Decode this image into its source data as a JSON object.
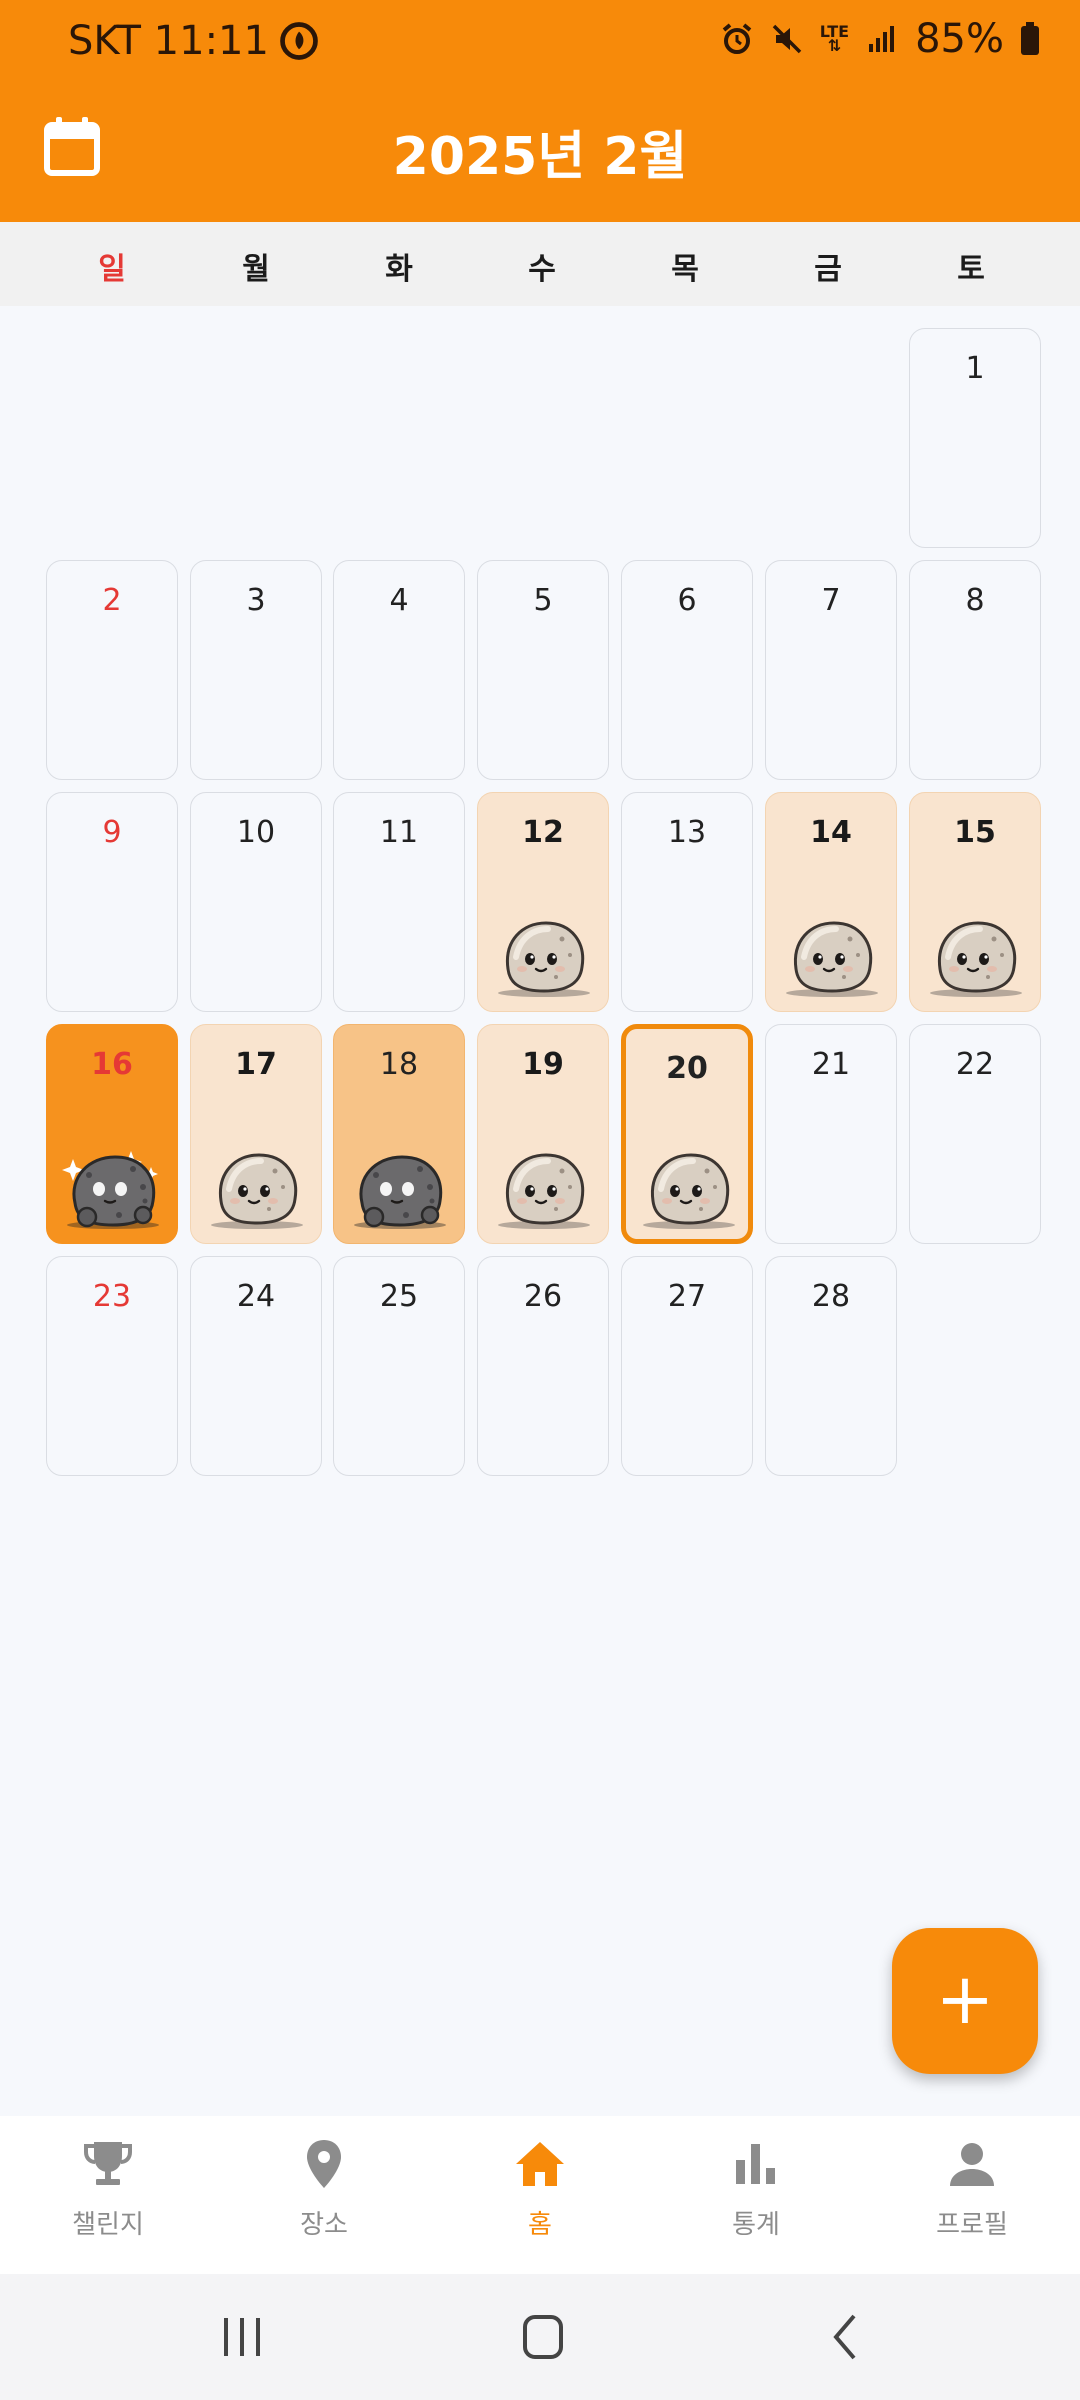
{
  "status_bar": {
    "carrier_time": "SKT 11:11",
    "lte": "LTE",
    "battery": "85%"
  },
  "header": {
    "title": "2025년 2월"
  },
  "weekdays": [
    "일",
    "월",
    "화",
    "수",
    "목",
    "금",
    "토"
  ],
  "days": {
    "d1": "1",
    "d2": "2",
    "d3": "3",
    "d4": "4",
    "d5": "5",
    "d6": "6",
    "d7": "7",
    "d8": "8",
    "d9": "9",
    "d10": "10",
    "d11": "11",
    "d12": "12",
    "d13": "13",
    "d14": "14",
    "d15": "15",
    "d16": "16",
    "d17": "17",
    "d18": "18",
    "d19": "19",
    "d20": "20",
    "d21": "21",
    "d22": "22",
    "d23": "23",
    "d24": "24",
    "d25": "25",
    "d26": "26",
    "d27": "27",
    "d28": "28"
  },
  "fab": {
    "label": "+"
  },
  "bottom_nav": [
    {
      "label": "챌린지",
      "icon": "trophy-icon"
    },
    {
      "label": "장소",
      "icon": "location-pin-icon"
    },
    {
      "label": "홈",
      "icon": "home-icon",
      "active": true
    },
    {
      "label": "통계",
      "icon": "bar-chart-icon"
    },
    {
      "label": "프로필",
      "icon": "person-icon"
    }
  ],
  "colors": {
    "primary": "#F78A0A",
    "sunday": "#E53935",
    "completed_bg": "#F9E4CF"
  }
}
